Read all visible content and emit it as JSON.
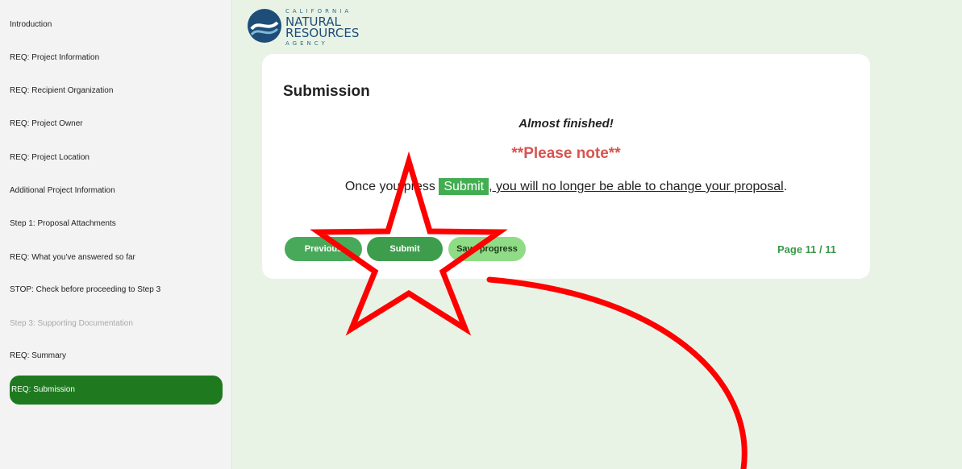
{
  "sidebar": {
    "items": [
      {
        "label": "Introduction",
        "state": "normal"
      },
      {
        "label": "REQ: Project Information",
        "state": "normal"
      },
      {
        "label": "REQ: Recipient Organization",
        "state": "normal"
      },
      {
        "label": "REQ: Project Owner",
        "state": "normal"
      },
      {
        "label": "REQ: Project Location",
        "state": "normal"
      },
      {
        "label": "Additional Project Information",
        "state": "normal"
      },
      {
        "label": "Step 1: Proposal Attachments",
        "state": "normal"
      },
      {
        "label": "REQ: What you've answered so far",
        "state": "normal"
      },
      {
        "label": "STOP: Check before proceeding to Step 3",
        "state": "normal"
      },
      {
        "label": "Step 3: Supporting Documentation",
        "state": "disabled"
      },
      {
        "label": "REQ: Summary",
        "state": "normal"
      },
      {
        "label": "REQ: Submission",
        "state": "active"
      }
    ]
  },
  "logo": {
    "line1": "CALIFORNIA",
    "line2": "NATURAL",
    "line3": "RESOURCES",
    "line4": "AGENCY"
  },
  "card": {
    "title": "Submission",
    "almost": "Almost finished!",
    "note": "**Please note**",
    "sentence_prefix": "Once you press ",
    "sentence_highlight": "Submit",
    "sentence_link": ", you will no longer be able to change your proposal",
    "sentence_suffix": "."
  },
  "buttons": {
    "previous": "Previous",
    "submit": "Submit",
    "save": "Save progress"
  },
  "pager": "Page 11 / 11",
  "colors": {
    "active_nav": "#1f7a1f",
    "background": "#e8f3e6",
    "note_red": "#d9534f",
    "annotation_red": "#ff0000"
  }
}
